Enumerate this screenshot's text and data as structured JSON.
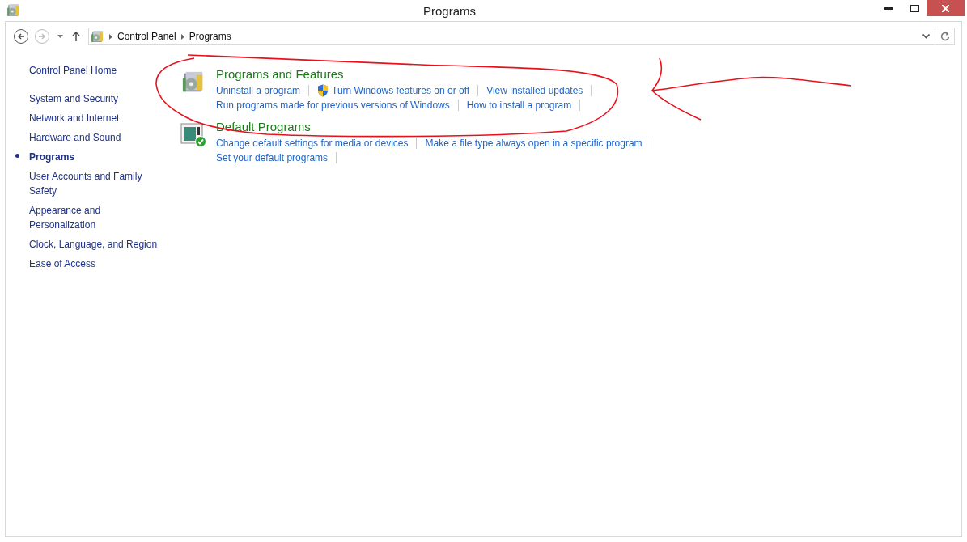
{
  "window": {
    "title": "Programs"
  },
  "address_bar": {
    "path": [
      "Control Panel",
      "Programs"
    ]
  },
  "sidebar": {
    "home": "Control Panel Home",
    "items": [
      {
        "label": "System and Security",
        "selected": false
      },
      {
        "label": "Network and Internet",
        "selected": false
      },
      {
        "label": "Hardware and Sound",
        "selected": false
      },
      {
        "label": "Programs",
        "selected": true
      },
      {
        "label": "User Accounts and Family Safety",
        "selected": false
      },
      {
        "label": "Appearance and Personalization",
        "selected": false
      },
      {
        "label": "Clock, Language, and Region",
        "selected": false
      },
      {
        "label": "Ease of Access",
        "selected": false
      }
    ]
  },
  "sections": [
    {
      "kind": "features",
      "title": "Programs and Features",
      "lines": [
        [
          {
            "label": "Uninstall a program",
            "shield": false
          },
          {
            "label": "Turn Windows features on or off",
            "shield": true
          },
          {
            "label": "View installed updates",
            "shield": false
          }
        ],
        [
          {
            "label": "Run programs made for previous versions of Windows",
            "shield": false
          },
          {
            "label": "How to install a program",
            "shield": false
          }
        ]
      ]
    },
    {
      "kind": "defaults",
      "title": "Default Programs",
      "lines": [
        [
          {
            "label": "Change default settings for media or devices",
            "shield": false
          },
          {
            "label": "Make a file type always open in a specific program",
            "shield": false
          }
        ],
        [
          {
            "label": "Set your default programs",
            "shield": false
          }
        ]
      ]
    }
  ]
}
